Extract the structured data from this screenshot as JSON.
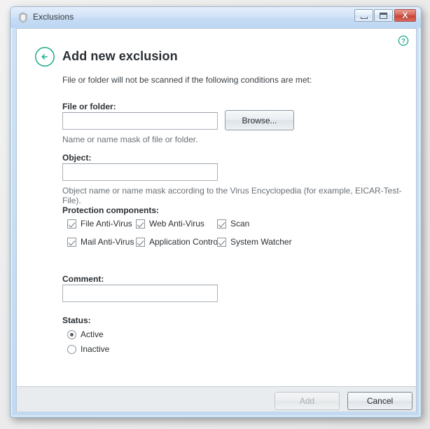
{
  "window": {
    "title": "Exclusions",
    "icon": "shield-icon",
    "controls": {
      "minimize": "Minimize",
      "maximize": "Maximize",
      "close": "Close",
      "close_glyph": "X"
    }
  },
  "header": {
    "back_label": "Back",
    "back_glyph": "←",
    "title": "Add new exclusion",
    "help_label": "Help",
    "help_glyph": "?",
    "accent_color": "#1faa8f"
  },
  "form": {
    "intro": "File or folder will not be scanned if the following conditions are met:",
    "file_or_folder": {
      "label": "File or folder:",
      "value": "",
      "placeholder": "",
      "hint": "Name or name mask of file or folder.",
      "browse_label": "Browse..."
    },
    "object": {
      "label": "Object:",
      "value": "",
      "placeholder": "",
      "hint": "Object name or name mask according to the Virus Encyclopedia (for example, EICAR-Test-File)."
    },
    "protection_components": {
      "label": "Protection components:",
      "items": [
        {
          "label": "File Anti-Virus",
          "checked": true
        },
        {
          "label": "Web Anti-Virus",
          "checked": true
        },
        {
          "label": "Scan",
          "checked": true
        },
        {
          "label": "Mail Anti-Virus",
          "checked": true
        },
        {
          "label": "Application Control",
          "checked": true
        },
        {
          "label": "System Watcher",
          "checked": true
        }
      ]
    },
    "comment": {
      "label": "Comment:",
      "value": "",
      "placeholder": ""
    },
    "status": {
      "label": "Status:",
      "options": [
        {
          "label": "Active",
          "selected": true
        },
        {
          "label": "Inactive",
          "selected": false
        }
      ]
    }
  },
  "footer": {
    "add_label": "Add",
    "add_disabled": true,
    "cancel_label": "Cancel"
  }
}
